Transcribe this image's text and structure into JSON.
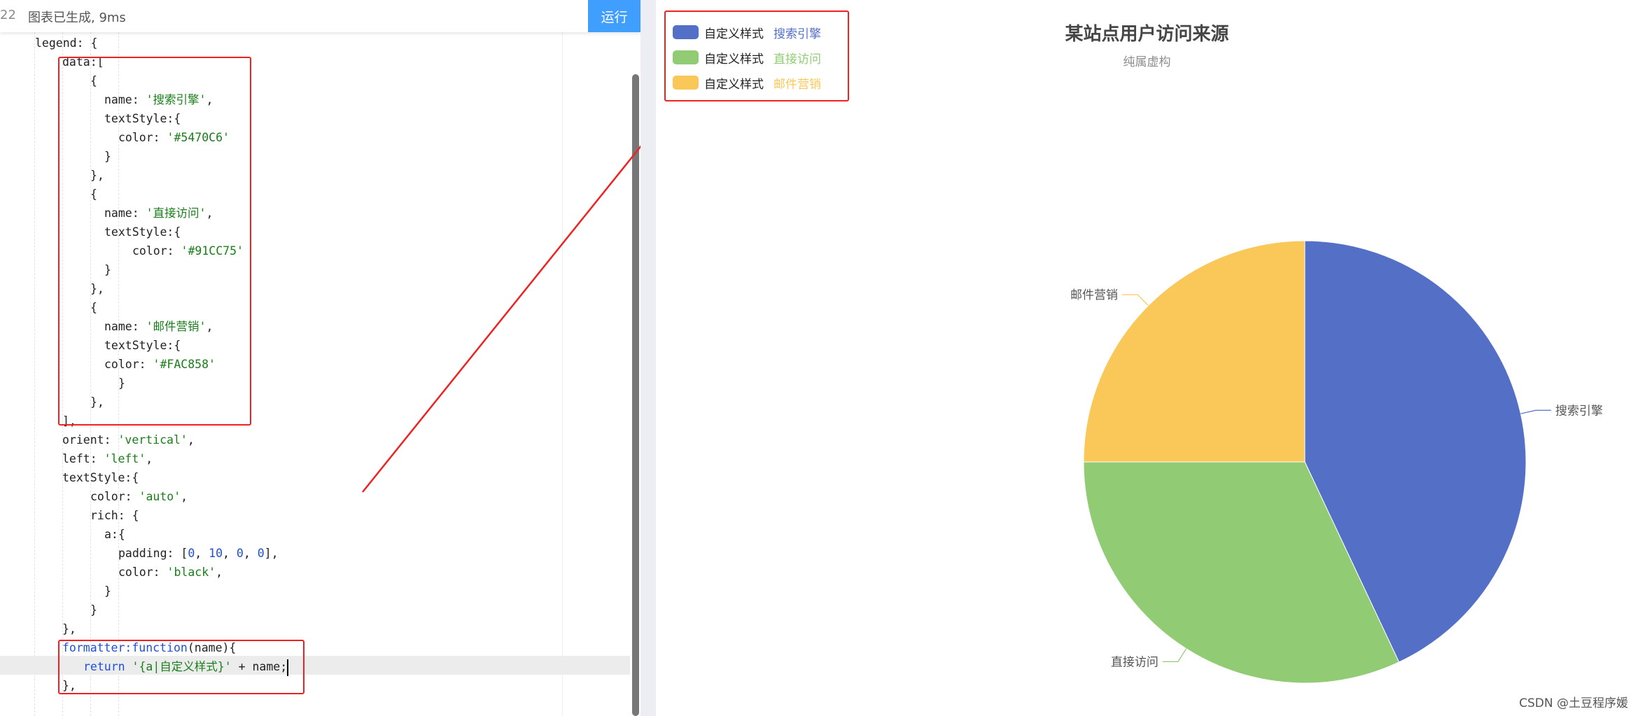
{
  "editor": {
    "line_number": "22",
    "status": "图表已生成, 9ms",
    "run_label": "运行",
    "code": {
      "legend_open": "legend: {",
      "data_open": "data:[",
      "brace_open": "{",
      "name_key": "name: ",
      "item1_name": "'搜索引擎'",
      "textstyle_open": "textStyle:{",
      "color_key": "color: ",
      "item1_color": "'#5470C6'",
      "brace_close": "}",
      "brace_close_comma": "},",
      "item2_name": "'直接访问'",
      "item2_color": "'#91CC75'",
      "item3_name": "'邮件营销'",
      "item3_color": "'#FAC858'",
      "data_close": "],",
      "orient_key": "orient: ",
      "orient_val": "'vertical'",
      "left_key": "left: ",
      "left_val": "'left'",
      "ts_color_val": "'auto'",
      "rich_open": "rich: {",
      "a_open": "a:{",
      "padding_key": "padding: ",
      "padding_open": "[",
      "pad0": "0",
      "pad10": "10",
      "pad_close": "],",
      "sep": ", ",
      "a_color_val": "'black'",
      "formatter_key": "formatter:",
      "function_kw": "function",
      "formatter_param": "(name){",
      "return_kw": "return ",
      "return_str": "'{a|自定义样式}'",
      "return_rest": " + name;",
      "comma": ","
    }
  },
  "chart": {
    "title": "某站点用户访问来源",
    "subtitle": "纯属虚构",
    "legend_prefix": "自定义样式",
    "watermark": "CSDN @土豆程序媛"
  },
  "chart_data": {
    "type": "pie",
    "title": "某站点用户访问来源",
    "subtitle": "纯属虚构",
    "legend_position": "top-left",
    "legend_orient": "vertical",
    "categories": [
      "搜索引擎",
      "直接访问",
      "邮件营销"
    ],
    "values": [
      43,
      32,
      25
    ],
    "colors": [
      "#5470C6",
      "#91CC75",
      "#FAC858"
    ]
  }
}
